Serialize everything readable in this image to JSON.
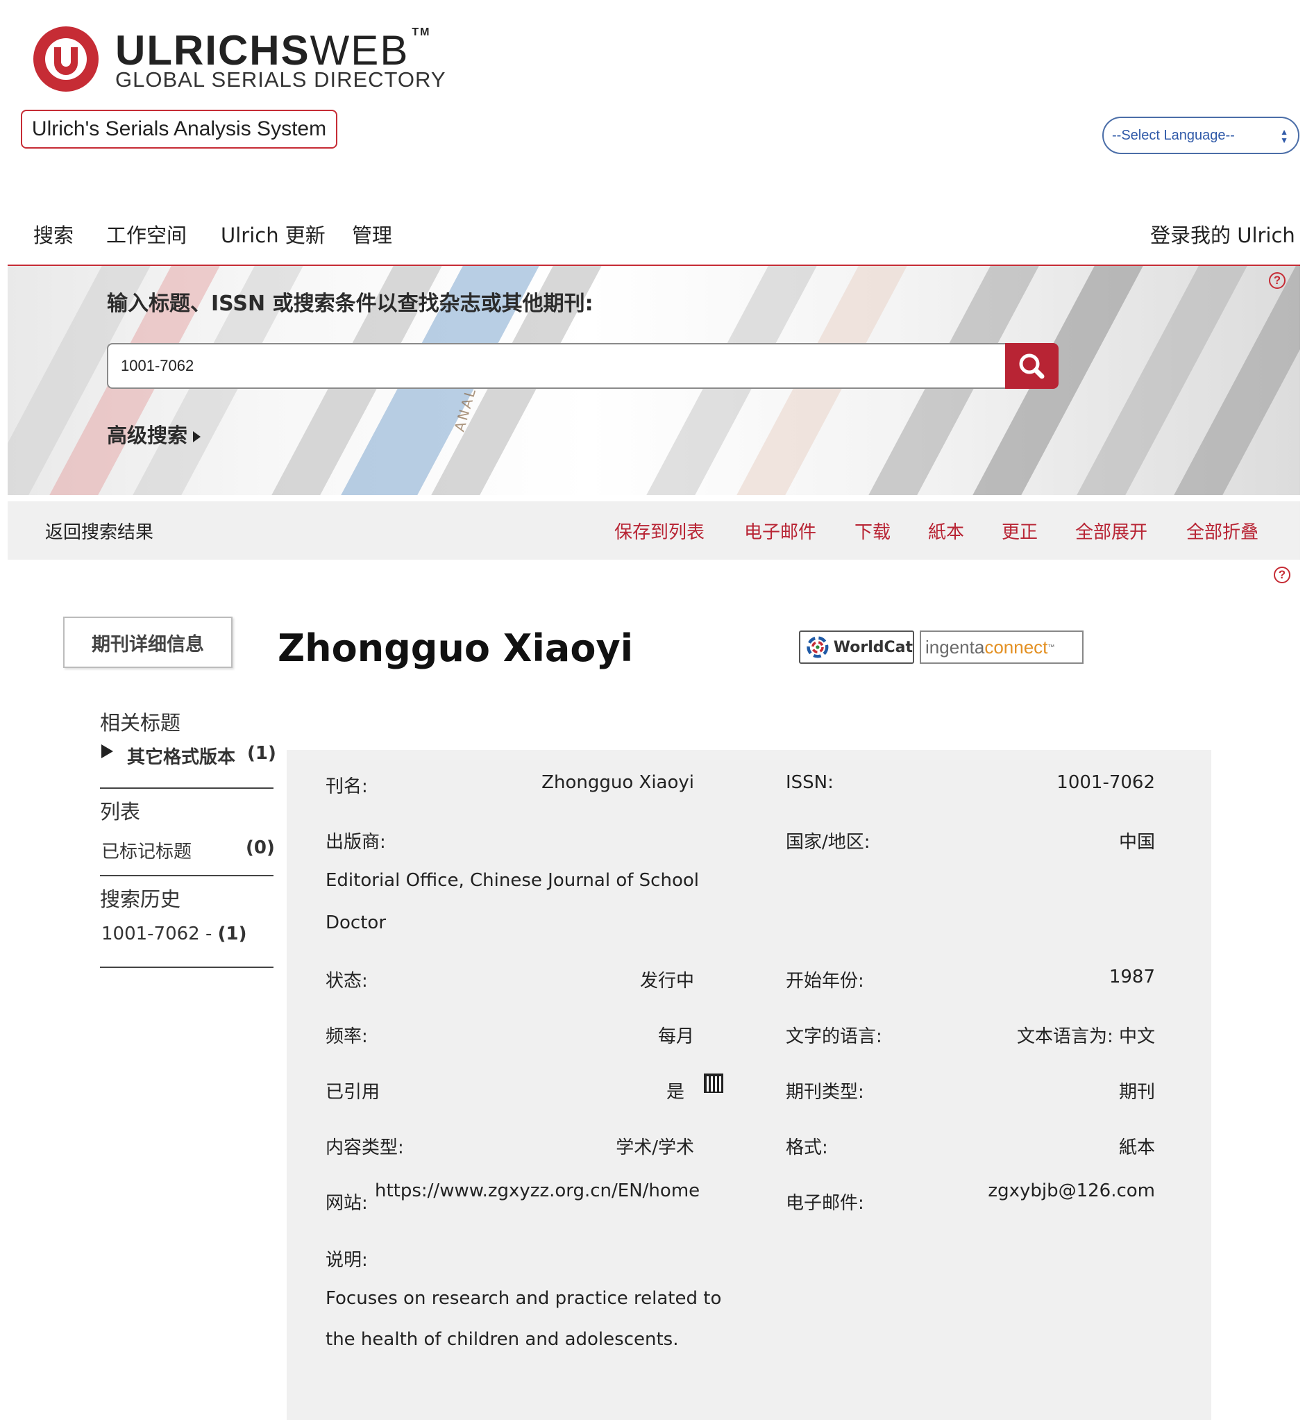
{
  "header": {
    "logo_bold": "ULRICHS",
    "logo_light": "WEB",
    "logo_tm": "TM",
    "logo_subtitle": "GLOBAL SERIALS DIRECTORY",
    "analysis_button": "Ulrich's Serials Analysis System",
    "language_select": "--Select Language--"
  },
  "nav": {
    "search": "搜索",
    "workspace": "工作空间",
    "updates": "Ulrich 更新",
    "admin": "管理",
    "login": "登录我的 Ulrich"
  },
  "banner": {
    "label": "输入标题、ISSN 或搜索条件以查找杂志或其他期刊:",
    "search_value": "1001-7062",
    "advanced_search": "高级搜索",
    "book_spine_text": "ANALOGY"
  },
  "toolbar": {
    "back": "返回搜索结果",
    "save": "保存到列表",
    "email": "电子邮件",
    "download": "下载",
    "print": "紙本",
    "correct": "更正",
    "expand_all": "全部展开",
    "collapse_all": "全部折叠"
  },
  "detail": {
    "tab": "期刊详细信息",
    "title": "Zhongguo Xiaoyi",
    "worldcat": "WorldCat",
    "ingenta_1": "ingenta",
    "ingenta_2": "connect",
    "ingenta_tm": "™"
  },
  "sidebar": {
    "related_heading": "相关标题",
    "other_formats": "其它格式版本",
    "other_formats_count": "(1)",
    "lists_heading": "列表",
    "marked_titles": "已标记标题",
    "marked_count": "(0)",
    "history_heading": "搜索历史",
    "history_item": "1001-7062 - ",
    "history_count": "(1)"
  },
  "info": {
    "title_label": "刊名:",
    "title_value": "Zhongguo Xiaoyi",
    "issn_label": "ISSN:",
    "issn_value": "1001-7062",
    "publisher_label": "出版商:",
    "publisher_value_1": "Editorial Office, Chinese Journal of School",
    "publisher_value_2": "Doctor",
    "country_label": "国家/地区:",
    "country_value": "中国",
    "status_label": "状态:",
    "status_value": "发行中",
    "start_label": "开始年份:",
    "start_value": "1987",
    "frequency_label": "频率:",
    "frequency_value": "每月",
    "language_label": "文字的语言:",
    "language_value": "文本语言为: 中文",
    "refereed_label": "已引用",
    "refereed_value": "是",
    "type_label": "期刊类型:",
    "type_value": "期刊",
    "content_label": "内容类型:",
    "content_value": "学术/学术",
    "format_label": "格式:",
    "format_value": "紙本",
    "website_label": "网站:",
    "website_value": "https://www.zgxyzz.org.cn/EN/home",
    "email_label": "电子邮件:",
    "email_value": "zgxybjb@126.com",
    "description_label": "说明:",
    "description_1": "Focuses on research and practice related to",
    "description_2": "the health of children and adolescents."
  }
}
